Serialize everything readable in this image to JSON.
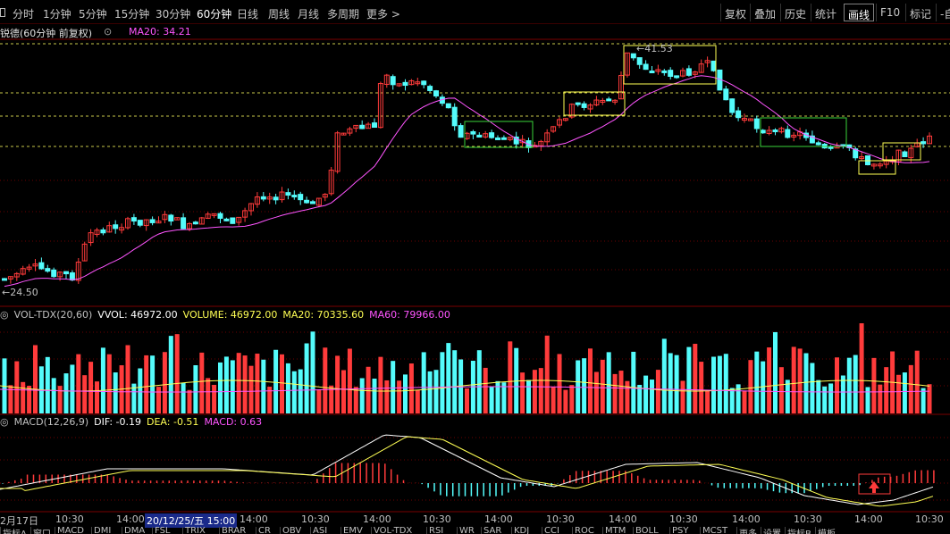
{
  "toolbar": {
    "timeframes": [
      "分时",
      "1分钟",
      "5分钟",
      "15分钟",
      "30分钟",
      "60分钟",
      "日线",
      "周线",
      "月线",
      "多周期",
      "更多 >"
    ],
    "active_timeframe": "60分钟",
    "buttons": [
      "复权",
      "叠加",
      "历史",
      "统计",
      "画线",
      "F10",
      "标记",
      "-自"
    ],
    "active_button": "画线"
  },
  "info": {
    "stock_name": "锐德(60分钟 前复权)",
    "ma_label": "MA20: 34.21"
  },
  "price_panel": {
    "high_label": "41.53",
    "low_label": "24.50"
  },
  "volume_panel": {
    "label": "VOL-TDX(20,60)",
    "vvol": "VVOL: 46972.00",
    "volume": "VOLUME: 46972.00",
    "ma20": "MA20: 70335.60",
    "ma60": "MA60: 79966.00"
  },
  "macd_panel": {
    "label": "MACD(12,26,9)",
    "dif": "DIF: -0.19",
    "dea": "DEA: -0.51",
    "macd": "MACD: 0.63"
  },
  "time_axis": [
    {
      "t": "2月17日"
    },
    {
      "t": "10:30"
    },
    {
      "t": "14:00"
    },
    {
      "t": "20/12/25/五 15:00",
      "hl": true
    },
    {
      "t": "14:00"
    },
    {
      "t": "10:30"
    },
    {
      "t": "14:00"
    },
    {
      "t": "10:30"
    },
    {
      "t": "14:00"
    },
    {
      "t": "10:30"
    },
    {
      "t": "14:00"
    },
    {
      "t": "10:30"
    },
    {
      "t": "14:00"
    },
    {
      "t": "10:30"
    },
    {
      "t": "14:00"
    },
    {
      "t": "10:30"
    }
  ],
  "bottom_tabs": [
    "指标A",
    "窗口",
    "MACD",
    "DMI",
    "DMA",
    "FSL",
    "TRIX",
    "BRAR",
    "CR",
    "OBV",
    "ASI",
    "EMV",
    "VOL-TDX",
    "RSI",
    "WR",
    "SAR",
    "KDJ",
    "CCI",
    "ROC",
    "MTM",
    "BOLL",
    "PSY",
    "MCST",
    "更多",
    "设置",
    "指标B",
    "模板"
  ],
  "colors": {
    "up": "#ff3b3b",
    "down": "#54fcfc",
    "ma_price": "#ff55ff",
    "yellow": "#ffff54",
    "white": "#ffffff",
    "grid": "#8b0000"
  }
}
